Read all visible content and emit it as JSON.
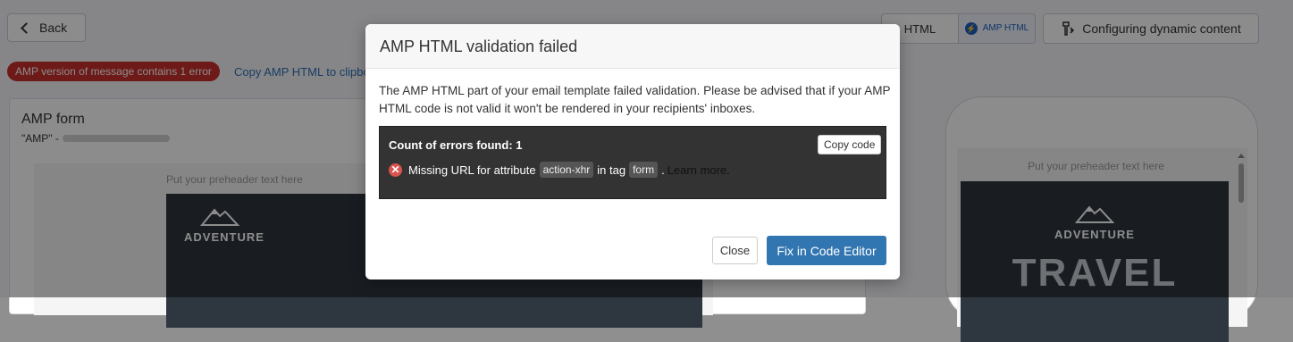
{
  "topbar": {
    "back_label": "Back",
    "mode_html_label": "HTML",
    "mode_amp_label": "AMP HTML",
    "dynamic_label": "Configuring dynamic content"
  },
  "status": {
    "error_badge": "AMP version of message contains 1 error",
    "copy_link": "Copy AMP HTML to clipbo"
  },
  "left_panel": {
    "title": "AMP form",
    "subtitle": "\"AMP\" -",
    "preheader": "Put your preheader text here",
    "brand": "ADVENTURE"
  },
  "phone": {
    "preheader": "Put your preheader text here",
    "brand": "ADVENTURE",
    "hero_text": "TRAVEL"
  },
  "modal": {
    "title": "AMP HTML validation failed",
    "message": "The AMP HTML part of your email template failed validation. Please be advised that if your AMP HTML code is not valid it won't be rendered in your recipients' inboxes.",
    "error_count": "Count of errors found: 1",
    "copy_code_label": "Copy code",
    "error_text_1": "Missing URL for attribute",
    "error_attr": "action-xhr",
    "error_text_2": "in tag",
    "error_tag": "form",
    "error_text_3": ".",
    "learn_more": "Learn more.",
    "close_label": "Close",
    "fix_label": "Fix in Code Editor"
  },
  "colors": {
    "error_badge": "#c9302c",
    "primary_button": "#3276b1",
    "link": "#2e6fb7"
  }
}
